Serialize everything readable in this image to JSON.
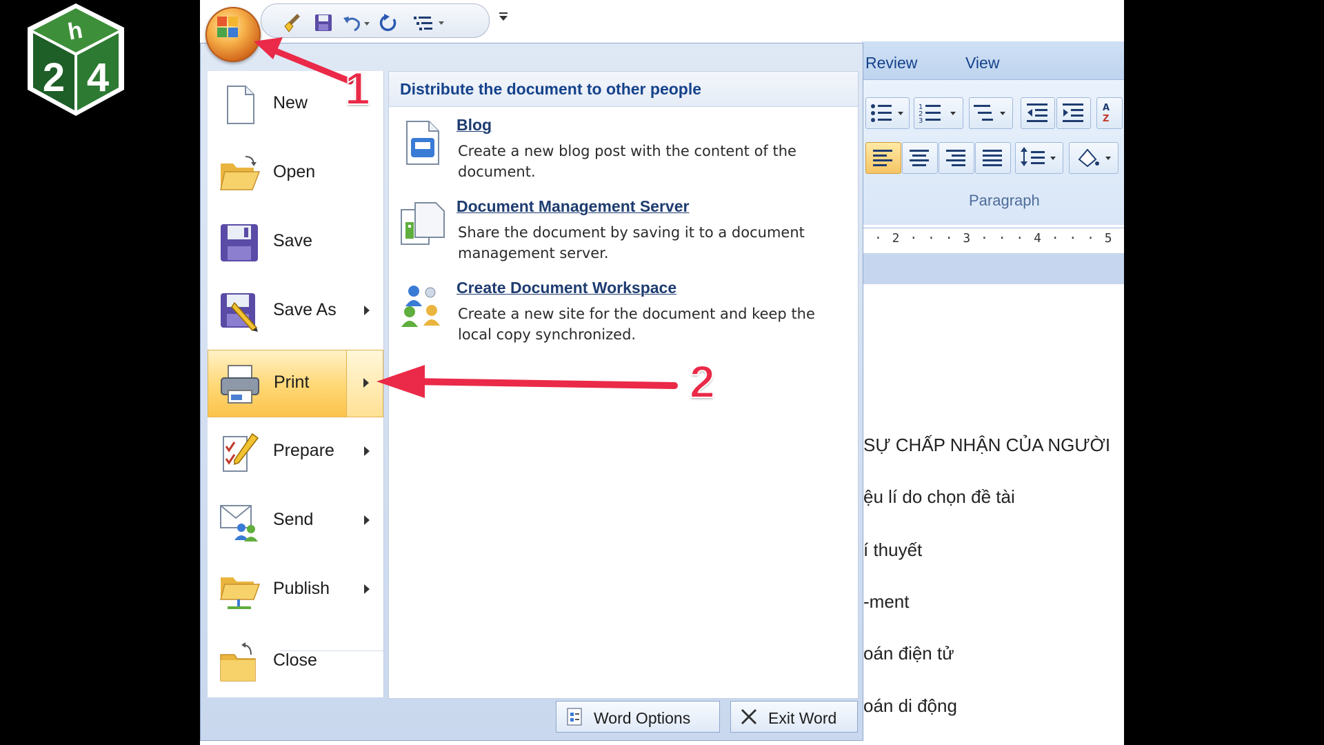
{
  "logo": {
    "digits": [
      "2",
      "4"
    ],
    "letter": "h"
  },
  "quick_access": {
    "icons": [
      "broom-icon",
      "save-icon",
      "undo-icon",
      "redo-icon",
      "list-icon",
      "customize-arrow-icon"
    ]
  },
  "ribbon": {
    "tabs": [
      {
        "label": "Review"
      },
      {
        "label": "View"
      }
    ],
    "group_label": "Paragraph",
    "ruler_text": "· 2 · · · 3 · · · 4 · · · 5 ·"
  },
  "document_lines": [
    "SỰ CHẤP NHẬN CỦA NGƯỜI",
    "ệu lí do chọn đề tài",
    "í thuyết",
    "-ment",
    "oán điện tử",
    "oán di động"
  ],
  "office_menu": {
    "items": [
      {
        "label": "New",
        "has_arrow": false
      },
      {
        "label": "Open",
        "has_arrow": false
      },
      {
        "label": "Save",
        "has_arrow": false
      },
      {
        "label": "Save As",
        "has_arrow": true
      },
      {
        "label": "Print",
        "has_arrow": true,
        "highlighted": true
      },
      {
        "label": "Prepare",
        "has_arrow": true
      },
      {
        "label": "Send",
        "has_arrow": true
      },
      {
        "label": "Publish",
        "has_arrow": true
      },
      {
        "label": "Close",
        "has_arrow": false
      }
    ],
    "panel_title": "Distribute the document to other people",
    "panel_items": [
      {
        "title": "Blog",
        "description": "Create a new blog post with the content of the document."
      },
      {
        "title": "Document Management Server",
        "description": "Share the document by saving it to a document management server."
      },
      {
        "title": "Create Document Workspace",
        "description": "Create a new site for the document and keep the local copy synchronized."
      }
    ],
    "footer": {
      "options_label": "Word Options",
      "exit_label": "Exit Word"
    }
  },
  "annotations": {
    "step1": "1",
    "step2": "2"
  },
  "colors": {
    "accent_red": "#ea2a48",
    "menu_hover": "#ffd773",
    "ribbon_blue": "#15428b"
  }
}
